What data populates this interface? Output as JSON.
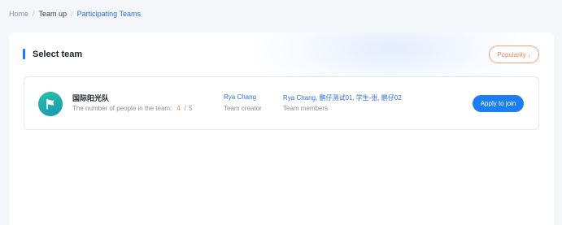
{
  "breadcrumb": {
    "items": [
      "Home",
      "Team up",
      "Participating Teams"
    ],
    "separator": "/"
  },
  "panel": {
    "title": "Select team",
    "sort_label": "Popularity",
    "sort_icon": "↓"
  },
  "teams": [
    {
      "name": "国际阳光队",
      "avatar_icon": "flag-icon",
      "count_label": "The number of people in the team:",
      "count_current": "4",
      "count_separator": "/",
      "count_max": "5",
      "creator": "Rya Chang",
      "creator_label": "Team creator",
      "members": "Rya Chang, 鹏仔测试01, 学生-张, 鹏仔02",
      "members_label": "Team members",
      "apply_label": "Apply to join"
    }
  ],
  "colors": {
    "accent": "#1c7ef0",
    "link": "#2d6cdf",
    "warm": "#ee8551",
    "avatar": "#1fa9ad"
  }
}
